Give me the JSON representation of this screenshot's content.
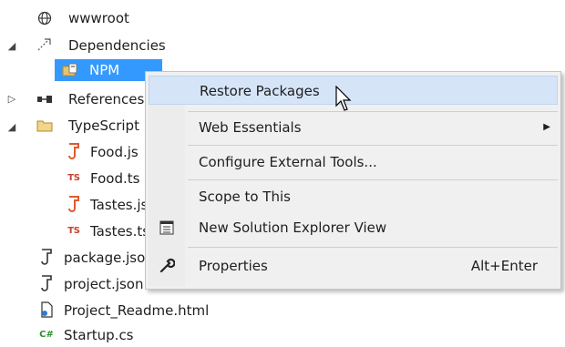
{
  "tree": {
    "wwwroot": "wwwroot",
    "dependencies": "Dependencies",
    "npm": "NPM",
    "references": "References",
    "typescript": "TypeScript",
    "food_js": "Food.js",
    "food_ts": "Food.ts",
    "tastes_js": "Tastes.js",
    "tastes_ts": "Tastes.ts",
    "package_json": "package.json",
    "project_json": "project.json",
    "readme": "Project_Readme.html",
    "startup": "Startup.cs",
    "ts_badge": "TS",
    "cs_badge": "C#"
  },
  "menu": {
    "restore": "Restore Packages",
    "web_essentials": "Web Essentials",
    "configure": "Configure External Tools...",
    "scope": "Scope to This",
    "new_view": "New Solution Explorer View",
    "properties": "Properties",
    "properties_shortcut": "Alt+Enter"
  },
  "colors": {
    "selection": "#3399ff",
    "menu_bg": "#f0f0f0",
    "hover_bg": "#d6e4f8"
  }
}
